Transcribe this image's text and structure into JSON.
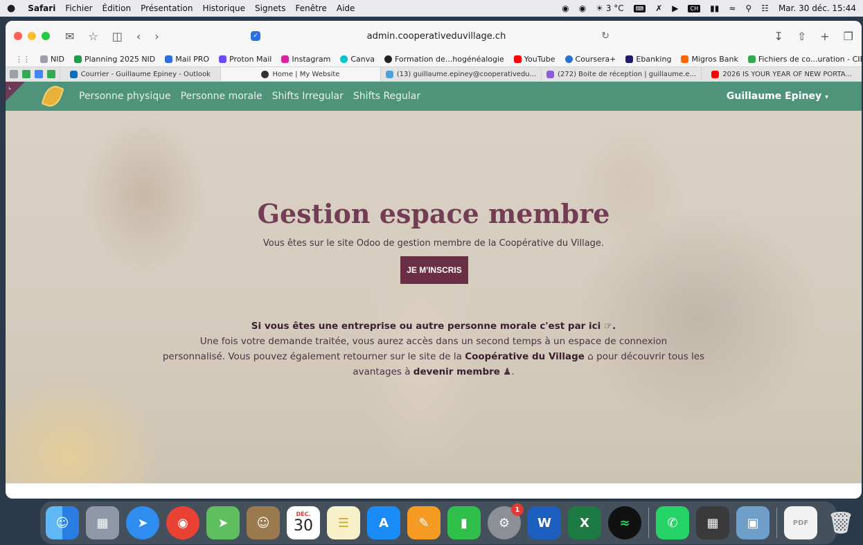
{
  "menubar": {
    "app": "Safari",
    "items": [
      "Fichier",
      "Édition",
      "Présentation",
      "Historique",
      "Signets",
      "Fenêtre",
      "Aide"
    ],
    "weather": "3 °C",
    "datetime": "Mar. 30 déc. 15:44"
  },
  "browser": {
    "url": "admin.cooperativeduvillage.ch",
    "bookmarks": [
      {
        "label": "NID",
        "color": "#9aa0a6"
      },
      {
        "label": "Planning 2025 NID",
        "color": "#1e9e4a"
      },
      {
        "label": "Mail PRO",
        "color": "#2f6fdc"
      },
      {
        "label": "Proton Mail",
        "color": "#6d4aff"
      },
      {
        "label": "Instagram",
        "color": "#d6249f"
      },
      {
        "label": "Canva",
        "color": "#00c4cc"
      },
      {
        "label": "Formation de...hogénéalogie",
        "color": "#222222"
      },
      {
        "label": "YouTube",
        "color": "#ff0000"
      },
      {
        "label": "Coursera+",
        "color": "#2a73cc"
      },
      {
        "label": "Ebanking",
        "color": "#1d1d6b"
      },
      {
        "label": "Migros Bank",
        "color": "#ff6600"
      },
      {
        "label": "Fichiers de co...uration - CIE",
        "color": "#34a853"
      }
    ],
    "tabs": [
      {
        "label": "Courrier - Guillaume Epiney - Outlook",
        "color": "#0f6cbd",
        "active": false
      },
      {
        "label": "Home | My Website",
        "color": "#333333",
        "active": true
      },
      {
        "label": "(13) guillaume.epiney@cooperativedu...",
        "color": "#4aa3df",
        "active": false
      },
      {
        "label": "(272) Boite de réception | guillaume.e...",
        "color": "#8e5ad8",
        "active": false
      },
      {
        "label": "2026 IS YOUR YEAR OF NEW PORTA...",
        "color": "#ff0000",
        "active": false
      }
    ]
  },
  "site": {
    "nav": [
      "Personne physique",
      "Personne morale",
      "Shifts Irregular",
      "Shifts Regular"
    ],
    "user": "Guillaume Epiney",
    "hero_title": "Gestion espace membre",
    "hero_sub": "Vous êtes sur le site Odoo de gestion membre de la Coopérative du Village.",
    "cta": "JE M'INSCRIS",
    "info_line1": "Si vous êtes une entreprise ou autre personne morale c'est par ici ☞.",
    "info_line2": "Une fois votre demande traitée, vous aurez accès dans un second temps à un espace de connexion",
    "info_line3a": "personnalisé. Vous pouvez également retourner sur le site de la",
    "info_link1": "Coopérative du Village",
    "info_line3b": "pour découvrir tous les",
    "info_line4a": "avantages à",
    "info_link2": "devenir membre",
    "colors": {
      "navbar": "#4e937a",
      "accent": "#6b2f45",
      "title": "#733e55"
    }
  },
  "dock": {
    "calendar_month": "DÉC.",
    "calendar_day": "30",
    "settings_badge": "1",
    "apps": [
      "finder-icon",
      "launchpad-icon",
      "safari-icon",
      "chrome-icon",
      "maps-icon",
      "contacts-icon",
      "calendar-icon",
      "notes-icon",
      "app-store-icon",
      "pages-icon",
      "numbers-icon",
      "settings-icon",
      "word-icon",
      "excel-icon",
      "spotify-icon",
      "whatsapp-icon",
      "calculator-icon",
      "preview-icon",
      "pdf-file-icon",
      "trash-icon"
    ]
  }
}
